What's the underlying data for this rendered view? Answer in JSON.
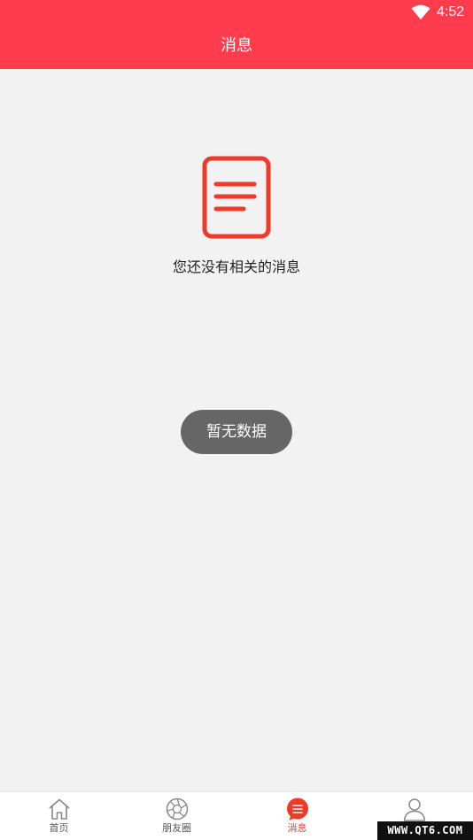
{
  "status_bar": {
    "time": "4:52"
  },
  "app_bar": {
    "title": "消息"
  },
  "empty_state": {
    "message": "您还没有相关的消息"
  },
  "toast": {
    "text": "暂无数据"
  },
  "tabs": [
    {
      "label": "首页",
      "icon": "home-icon",
      "active": false
    },
    {
      "label": "朋友圈",
      "icon": "aperture-icon",
      "active": false
    },
    {
      "label": "消息",
      "icon": "message-icon",
      "active": true
    },
    {
      "label": "",
      "icon": "profile-icon",
      "active": false
    }
  ],
  "watermark": "WWW.QT6.COM",
  "colors": {
    "primary": "#ff3b4e",
    "accent": "#ef3a2a",
    "background": "#f2f2f2",
    "toast": "#666666"
  }
}
